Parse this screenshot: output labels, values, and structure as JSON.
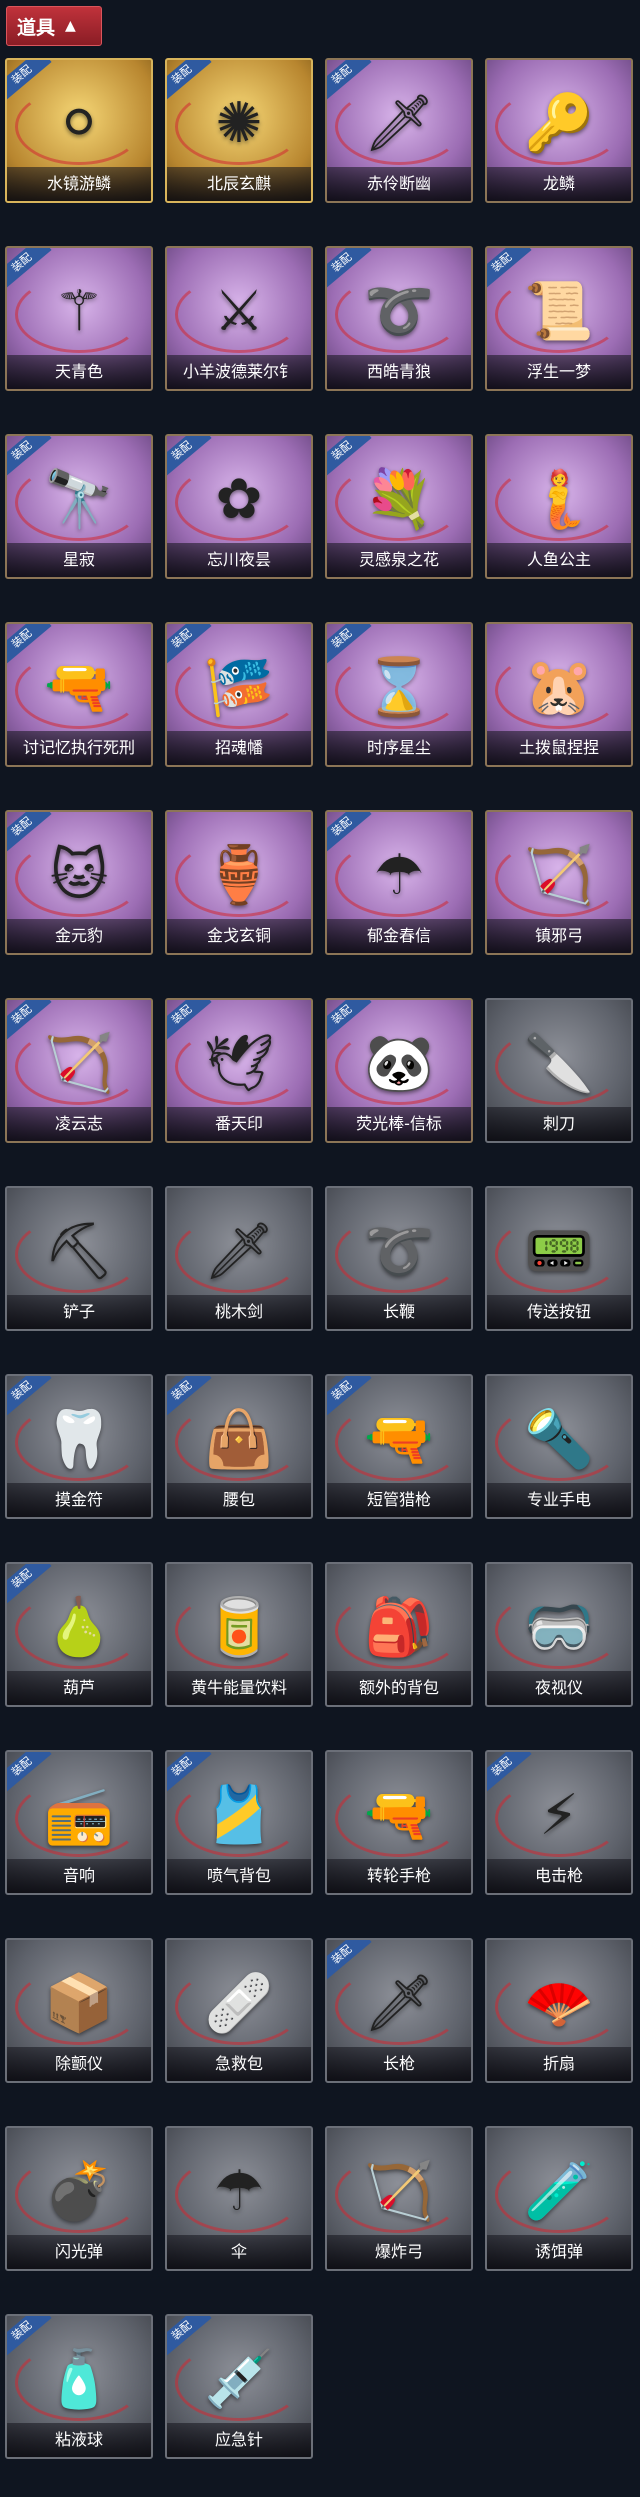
{
  "header": {
    "title": "道具",
    "chevron_icon": "chevron-up-icon"
  },
  "items": [
    {
      "label": "水镜游鳞",
      "equipped": true,
      "style": "gold",
      "icon": "⚪"
    },
    {
      "label": "北辰玄麒",
      "equipped": true,
      "style": "gold",
      "icon": "✺"
    },
    {
      "label": "赤伶断幽",
      "equipped": true,
      "style": "purple",
      "icon": "🗡"
    },
    {
      "label": "龙鳞",
      "equipped": false,
      "style": "purple",
      "icon": "🔑"
    },
    {
      "label": "天青色",
      "equipped": true,
      "style": "purple",
      "icon": "⚚"
    },
    {
      "label": "小羊波德莱尔钅",
      "equipped": false,
      "style": "purple",
      "icon": "⚔"
    },
    {
      "label": "西皓青狼",
      "equipped": true,
      "style": "purple",
      "icon": "➰"
    },
    {
      "label": "浮生一梦",
      "equipped": true,
      "style": "purple",
      "icon": "📜"
    },
    {
      "label": "星寂",
      "equipped": true,
      "style": "purple",
      "icon": "🔭"
    },
    {
      "label": "忘川夜昙",
      "equipped": true,
      "style": "purple",
      "icon": "✿"
    },
    {
      "label": "灵感泉之花",
      "equipped": true,
      "style": "purple",
      "icon": "💐"
    },
    {
      "label": "人鱼公主",
      "equipped": false,
      "style": "purple",
      "icon": "🧜"
    },
    {
      "label": "讨记忆执行死刑",
      "equipped": true,
      "style": "purple",
      "icon": "🔫"
    },
    {
      "label": "招魂幡",
      "equipped": true,
      "style": "purple",
      "icon": "🎏"
    },
    {
      "label": "时序星尘",
      "equipped": true,
      "style": "purple",
      "icon": "⌛"
    },
    {
      "label": "土拨鼠捏捏",
      "equipped": false,
      "style": "purple",
      "icon": "🐹"
    },
    {
      "label": "金元豹",
      "equipped": true,
      "style": "purple",
      "icon": "🐱"
    },
    {
      "label": "金戈玄铜",
      "equipped": false,
      "style": "purple",
      "icon": "🏺"
    },
    {
      "label": "郁金春信",
      "equipped": true,
      "style": "purple",
      "icon": "☂"
    },
    {
      "label": "镇邪弓",
      "equipped": false,
      "style": "purple",
      "icon": "🏹"
    },
    {
      "label": "凌云志",
      "equipped": true,
      "style": "purple",
      "icon": "🏹"
    },
    {
      "label": "番天印",
      "equipped": true,
      "style": "purple",
      "icon": "🕊"
    },
    {
      "label": "荧光棒-信标",
      "equipped": true,
      "style": "purple",
      "icon": "🐼"
    },
    {
      "label": "刺刀",
      "equipped": false,
      "style": "gray",
      "icon": "🔪"
    },
    {
      "label": "铲子",
      "equipped": false,
      "style": "gray",
      "icon": "⛏"
    },
    {
      "label": "桃木剑",
      "equipped": false,
      "style": "gray",
      "icon": "🗡"
    },
    {
      "label": "长鞭",
      "equipped": false,
      "style": "gray",
      "icon": "➰"
    },
    {
      "label": "传送按钮",
      "equipped": false,
      "style": "gray",
      "icon": "📟"
    },
    {
      "label": "摸金符",
      "equipped": true,
      "style": "gray",
      "icon": "🦷"
    },
    {
      "label": "腰包",
      "equipped": true,
      "style": "gray",
      "icon": "👜"
    },
    {
      "label": "短管猎枪",
      "equipped": true,
      "style": "gray",
      "icon": "🔫"
    },
    {
      "label": "专业手电",
      "equipped": false,
      "style": "gray",
      "icon": "🔦"
    },
    {
      "label": "葫芦",
      "equipped": true,
      "style": "gray",
      "icon": "🍐"
    },
    {
      "label": "黄牛能量饮料",
      "equipped": false,
      "style": "gray",
      "icon": "🥫"
    },
    {
      "label": "额外的背包",
      "equipped": false,
      "style": "gray",
      "icon": "🎒"
    },
    {
      "label": "夜视仪",
      "equipped": false,
      "style": "gray",
      "icon": "🥽"
    },
    {
      "label": "音响",
      "equipped": true,
      "style": "gray",
      "icon": "📻"
    },
    {
      "label": "喷气背包",
      "equipped": true,
      "style": "gray",
      "icon": "🎽"
    },
    {
      "label": "转轮手枪",
      "equipped": false,
      "style": "gray",
      "icon": "🔫"
    },
    {
      "label": "电击枪",
      "equipped": true,
      "style": "gray",
      "icon": "⚡"
    },
    {
      "label": "除颤仪",
      "equipped": false,
      "style": "gray",
      "icon": "📦"
    },
    {
      "label": "急救包",
      "equipped": false,
      "style": "gray",
      "icon": "🩹"
    },
    {
      "label": "长枪",
      "equipped": true,
      "style": "gray",
      "icon": "🗡"
    },
    {
      "label": "折扇",
      "equipped": false,
      "style": "gray",
      "icon": "🪭"
    },
    {
      "label": "闪光弹",
      "equipped": false,
      "style": "gray",
      "icon": "💣"
    },
    {
      "label": "伞",
      "equipped": false,
      "style": "gray",
      "icon": "☂"
    },
    {
      "label": "爆炸弓",
      "equipped": false,
      "style": "gray",
      "icon": "🏹"
    },
    {
      "label": "诱饵弹",
      "equipped": false,
      "style": "gray",
      "icon": "🧪"
    },
    {
      "label": "粘液球",
      "equipped": true,
      "style": "gray",
      "icon": "🧴"
    },
    {
      "label": "应急针",
      "equipped": true,
      "style": "gray",
      "icon": "💉"
    }
  ],
  "badge_text": "装配"
}
